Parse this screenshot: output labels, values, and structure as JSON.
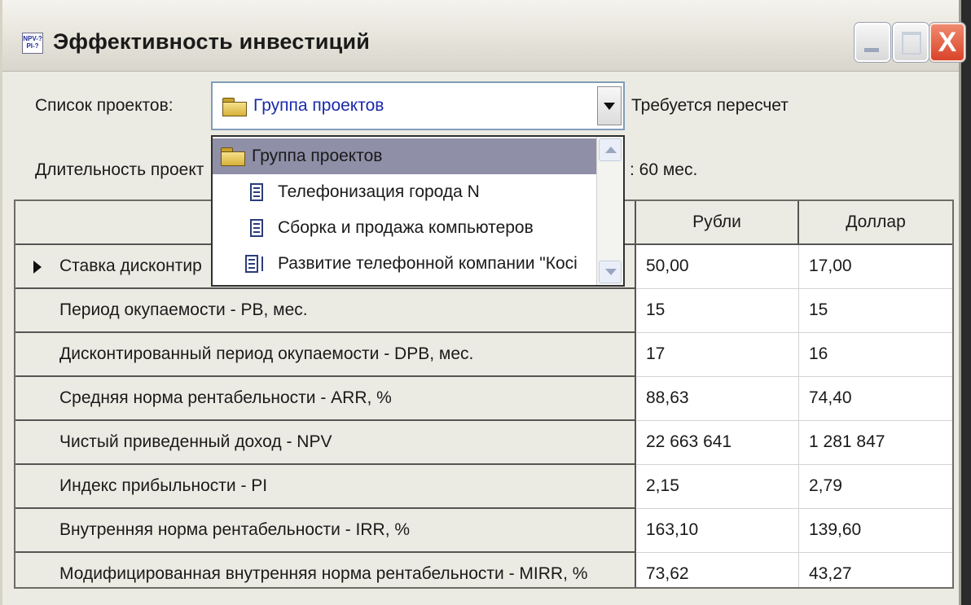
{
  "window": {
    "title": "Эффективность инвестиций",
    "icon_text": "NPV-? PI-?",
    "minimize_label": "_",
    "close_label": "X"
  },
  "projects": {
    "label": "Список проектов:",
    "selected": "Группа проектов",
    "status": "Требуется пересчет"
  },
  "duration": {
    "label_visible": "Длительность проект",
    "value_visible": ": 60 мес."
  },
  "dropdown": {
    "items": [
      {
        "label": "Группа проектов",
        "icon": "folder-icon",
        "selected": true
      },
      {
        "label": "Телефонизация города N",
        "icon": "document-icon",
        "selected": false
      },
      {
        "label": "Сборка и продажа компьютеров",
        "icon": "document-icon",
        "selected": false
      },
      {
        "label": "Развитие телефонной компании \"Косі",
        "icon": "multi-document-icon",
        "selected": false
      }
    ]
  },
  "table": {
    "headers": {
      "label": "",
      "rub": "Рубли",
      "usd": "Доллар"
    },
    "rows": [
      {
        "label": "Ставка дисконтир",
        "rub": "50,00",
        "usd": "17,00"
      },
      {
        "label": "Период окупаемости - PB, мес.",
        "rub": "15",
        "usd": "15"
      },
      {
        "label": "Дисконтированный период окупаемости - DPB, мес.",
        "rub": "17",
        "usd": "16"
      },
      {
        "label": "Средняя норма рентабельности - ARR, %",
        "rub": "88,63",
        "usd": "74,40"
      },
      {
        "label": "Чистый приведенный доход - NPV",
        "rub": "22 663 641",
        "usd": "1 281 847"
      },
      {
        "label": "Индекс прибыльности - PI",
        "rub": "2,15",
        "usd": "2,79"
      },
      {
        "label": "Внутренняя норма рентабельности - IRR, %",
        "rub": "163,10",
        "usd": "139,60"
      },
      {
        "label": "Модифицированная внутренняя норма рентабельности - MIRR, %",
        "rub": "73,62",
        "usd": "43,27"
      }
    ]
  },
  "colors": {
    "combo_text": "#1a2aa8",
    "dropdown_selected_bg": "#8f8fa8",
    "close_button": "#d9442a"
  }
}
